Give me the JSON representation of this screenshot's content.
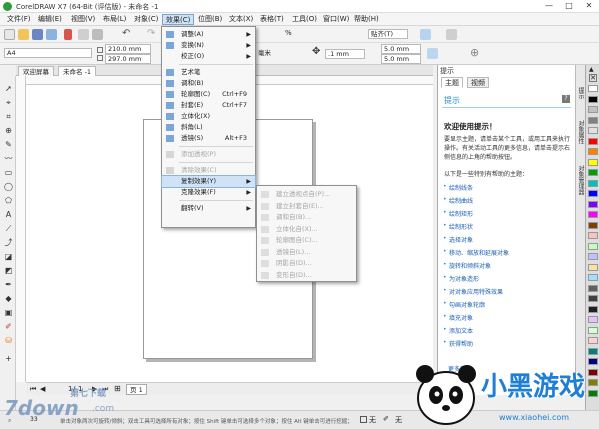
{
  "window": {
    "title": "CorelDRAW X7 (64-Bit (评估版) - 未命名 -1",
    "controls": [
      "—",
      "□",
      "✕"
    ]
  },
  "menubar": [
    {
      "label": "文件(F)"
    },
    {
      "label": "编辑(E)"
    },
    {
      "label": "视图(V)"
    },
    {
      "label": "布局(L)"
    },
    {
      "label": "对象(C)"
    },
    {
      "label": "效果(C)"
    },
    {
      "label": "位图(B)"
    },
    {
      "label": "文本(X)"
    },
    {
      "label": "表格(T)"
    },
    {
      "label": "工具(O)"
    },
    {
      "label": "窗口(W)"
    },
    {
      "label": "帮助(H)"
    }
  ],
  "toolbar1": {
    "zoom_suffix": "%",
    "snap_label": "贴齐(T)"
  },
  "property_bar": {
    "paper_size": "A4",
    "width": "210.0 mm",
    "height": "297.0 mm",
    "units": "毫米",
    "nudge": ".1 mm",
    "dup_x": "5.0 mm",
    "dup_y": "5.0 mm"
  },
  "doc_tabs": [
    "欢迎屏幕",
    "未命名 -1"
  ],
  "effects_menu": [
    {
      "label": "调整(A)",
      "submenu": true,
      "icon": "adjust-icon"
    },
    {
      "label": "变换(N)",
      "submenu": true,
      "icon": "transform-icon"
    },
    {
      "label": "校正(O)",
      "submenu": true,
      "icon": ""
    },
    {
      "separator": true
    },
    {
      "label": "艺术笔",
      "icon": "artistic-media-icon"
    },
    {
      "label": "调和(B)",
      "icon": "blend-icon"
    },
    {
      "label": "轮廓图(C)",
      "shortcut": "Ctrl+F9",
      "icon": "contour-icon"
    },
    {
      "label": "封套(E)",
      "shortcut": "Ctrl+F7",
      "icon": "envelope-icon"
    },
    {
      "label": "立体化(X)",
      "icon": "extrude-icon"
    },
    {
      "label": "斜角(L)",
      "icon": "bevel-icon"
    },
    {
      "label": "透镜(S)",
      "shortcut": "Alt+F3",
      "icon": "lens-icon"
    },
    {
      "separator": true
    },
    {
      "label": "添加透视(P)",
      "disabled": true,
      "icon": "perspective-icon"
    },
    {
      "separator": true
    },
    {
      "label": "清除效果(C)",
      "disabled": true,
      "icon": "clear-effect-icon"
    },
    {
      "label": "复制效果(Y)",
      "submenu": true,
      "highlighted": true,
      "icon": ""
    },
    {
      "label": "克隆效果(F)",
      "submenu": true,
      "icon": ""
    },
    {
      "separator": true
    },
    {
      "label": "翻转(V)",
      "submenu": true,
      "icon": ""
    }
  ],
  "copy_effect_submenu": [
    {
      "label": "建立透视点自(P)..."
    },
    {
      "label": "建立封套自(E)..."
    },
    {
      "label": "调和自(B)..."
    },
    {
      "label": "立体化自(X)..."
    },
    {
      "label": "轮廓图自(C)..."
    },
    {
      "label": "透镜自(L)..."
    },
    {
      "label": "阴影自(D)..."
    },
    {
      "label": "变形自(D)..."
    }
  ],
  "page_nav": {
    "current": "1",
    "separator": "/",
    "total": "1",
    "page_tab": "页 1"
  },
  "status": {
    "hint": "单击对象两次可旋转/倾斜；双击工具可选择所有对象；按住 Shift 键单击可选择多个对象；按住 Alt 键单击可进行挖掘；按住 Ctrl 并单击可在组中选择",
    "zoom_text": "33",
    "fill_none": "无",
    "outline_none": "无"
  },
  "docker": {
    "title": "提示",
    "tabs": [
      "主题",
      "视频"
    ],
    "banner": "提示",
    "welcome": "欢迎使用提示！",
    "intro": "要显示主题，请单击某个工具，或用工具来执行操作。有关活动工具的更多信息，请单击提示右侧信息的上角的帮助按钮。",
    "list_heading": "以下是一些特别有帮助的主题：",
    "links": [
      "绘制线条",
      "绘制曲线",
      "绘制矩形",
      "绘制形状",
      "选择对象",
      "移动、缩放和延展对象",
      "旋转和倾斜对象",
      "为对象造形",
      "对对象应用特殊效果",
      "勾画对象轮廓",
      "填充对象",
      "添加文本",
      "获得帮助"
    ],
    "footer": "更多帮助"
  },
  "side_tabs": [
    "提示",
    "对象属性",
    "对象管理器"
  ],
  "palette_colors": [
    "#ffffff",
    "#000000",
    "#c0c0c0",
    "#808080",
    "#e0e0e0",
    "#ff0000",
    "#ff8000",
    "#ffff00",
    "#00a000",
    "#00c0c0",
    "#0000ff",
    "#8000ff",
    "#ff00ff",
    "#804000",
    "#ffc0c0",
    "#c0ffc0",
    "#c0c0ff",
    "#ffe0a0",
    "#a0e0ff",
    "#606060",
    "#404040",
    "#202020",
    "#e8c0ff",
    "#d0ffd0",
    "#ffd0d0",
    "#008080",
    "#000080",
    "#800000",
    "#808000",
    "#008000"
  ],
  "watermarks": {
    "left_brand": "7down",
    "left_sub": ".com",
    "left_cn": "第七下载",
    "right_brand": "小黑游戏",
    "right_url": "www.xiaohei.com"
  }
}
